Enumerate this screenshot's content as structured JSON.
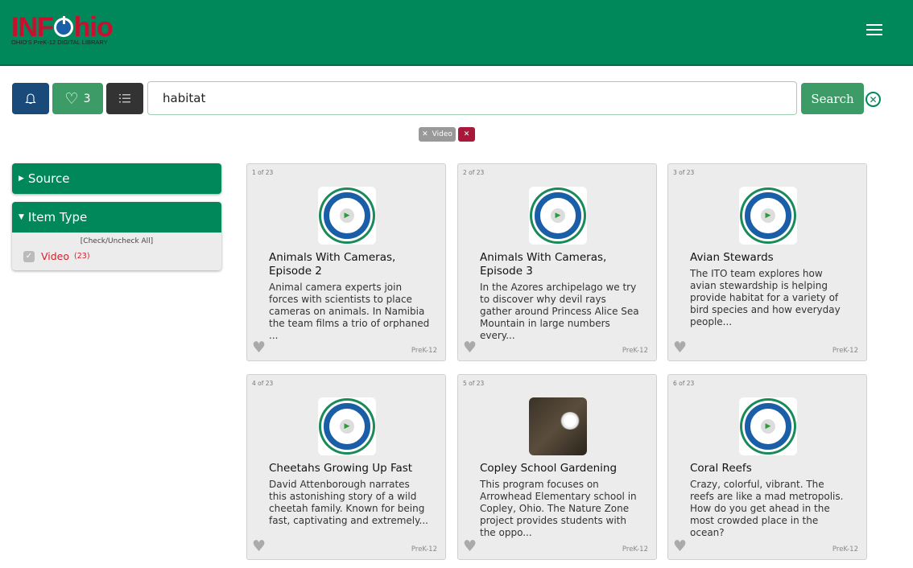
{
  "header": {
    "logo_text": "INFOhio",
    "logo_sub": "OHIO'S PreK-12 DIGITAL LIBRARY"
  },
  "toolbar": {
    "favorites_count": "3",
    "search_value": "habitat",
    "search_label": "Search"
  },
  "filters_applied": [
    {
      "label": "Video"
    }
  ],
  "colors": {
    "header": "#00875a",
    "bell_button": "#1a4a7a",
    "favorites_button": "#3d9b67",
    "list_button": "#333333",
    "remove_tag": "#a8183a"
  },
  "sidebar": {
    "source_label": "Source",
    "item_type_label": "Item Type",
    "check_all": "[Check/Uncheck All]",
    "options": [
      {
        "label": "Video",
        "count": "(23)",
        "checked": true
      }
    ]
  },
  "results": [
    {
      "count": "1 of 23",
      "title": "Animals With Cameras, Episode 2",
      "desc": "Animal camera experts join forces with scientists to place cameras on animals. In Namibia the team films a trio of orphaned ...",
      "grade": "PreK-12",
      "thumb": "digital-video-collection"
    },
    {
      "count": "2 of 23",
      "title": "Animals With Cameras, Episode 3",
      "desc": "In the Azores archipelago we try to discover why devil rays gather around Princess Alice Sea Mountain in large numbers every...",
      "grade": "PreK-12",
      "thumb": "digital-video-collection"
    },
    {
      "count": "3 of 23",
      "title": "Avian Stewards",
      "desc": "The ITO team explores how avian stewardship is helping provide habitat for a variety of bird species and how everyday people...",
      "grade": "PreK-12",
      "thumb": "digital-video-collection"
    },
    {
      "count": "4 of 23",
      "title": "Cheetahs Growing Up Fast",
      "desc": "David Attenborough narrates this astonishing story of a wild cheetah family. Known for being fast, captivating and extremely...",
      "grade": "PreK-12",
      "thumb": "digital-video-collection"
    },
    {
      "count": "5 of 23",
      "title": "Copley School Gardening",
      "desc": "This program focuses on Arrowhead Elementary school in Copley, Ohio. The Nature Zone project provides students with the oppo...",
      "grade": "PreK-12",
      "thumb": "photo"
    },
    {
      "count": "6 of 23",
      "title": "Coral Reefs",
      "desc": "Crazy, colorful, vibrant. The reefs are like a mad metropolis. How do you get ahead in the most crowded place in the ocean?",
      "grade": "PreK-12",
      "thumb": "digital-video-collection"
    }
  ]
}
